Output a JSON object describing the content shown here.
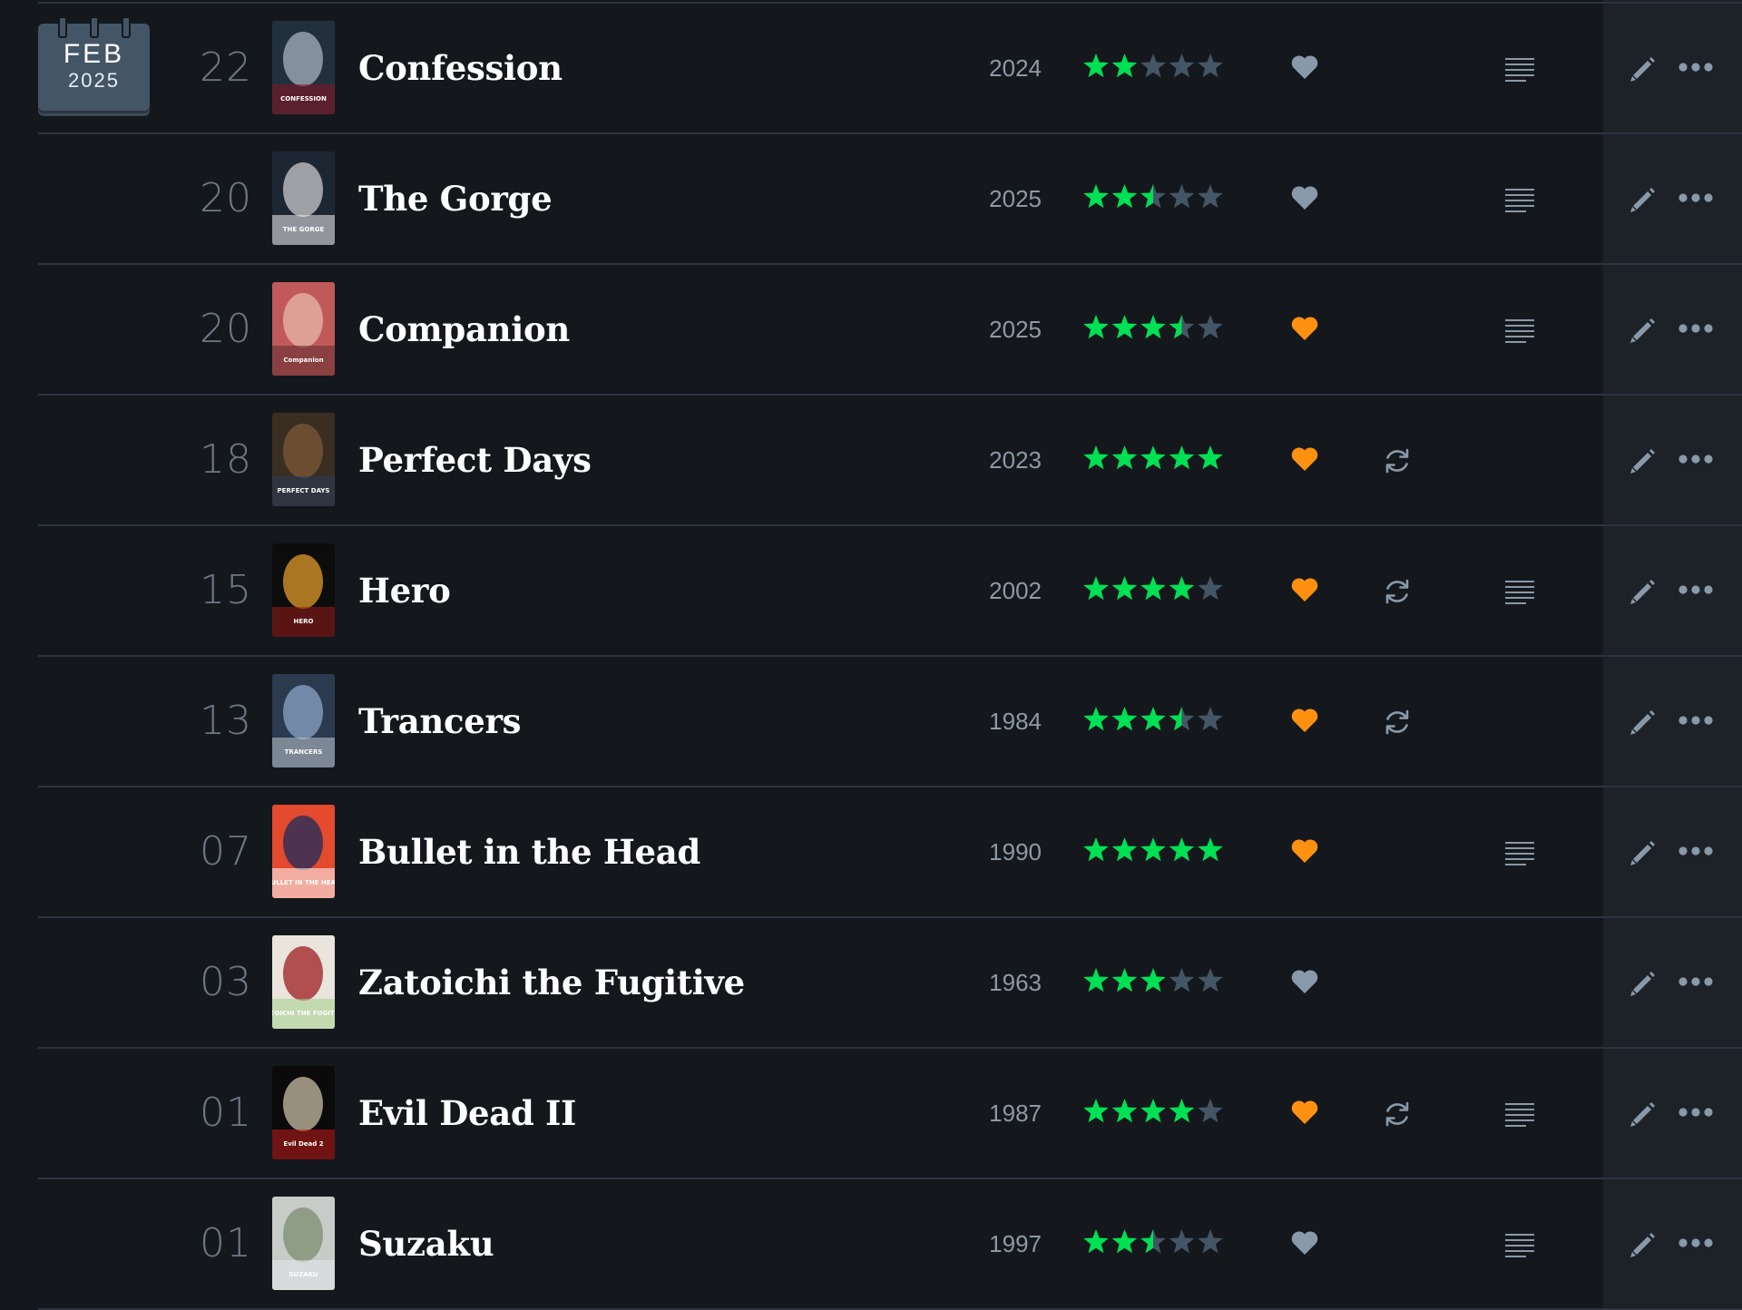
{
  "calendar": {
    "month": "FEB",
    "year": "2025"
  },
  "colors": {
    "star_on": "#00e054",
    "star_off": "#445566",
    "like_on": "#ff9010",
    "like_off": "#8899aa",
    "icon": "#8899aa",
    "background": "#14181c",
    "actions_background": "#1c2228"
  },
  "entries": [
    {
      "day": "22",
      "title": "Confession",
      "year": "2024",
      "rating": 2,
      "liked": false,
      "rewatch": false,
      "review": true,
      "poster_palette": [
        "#22303e",
        "#a6b0bb",
        "#8a1420"
      ],
      "poster_text": "CONFESSION"
    },
    {
      "day": "20",
      "title": "The Gorge",
      "year": "2025",
      "rating": 2.5,
      "liked": false,
      "rewatch": false,
      "review": true,
      "poster_palette": [
        "#1d2633",
        "#c9c9cc",
        "#f2f2f2"
      ],
      "poster_text": "THE GORGE"
    },
    {
      "day": "20",
      "title": "Companion",
      "year": "2025",
      "rating": 3.5,
      "liked": true,
      "rewatch": false,
      "review": true,
      "poster_palette": [
        "#c05a5a",
        "#e8b7a8",
        "#5c2c2c"
      ],
      "poster_text": "Companion"
    },
    {
      "day": "18",
      "title": "Perfect Days",
      "year": "2023",
      "rating": 5,
      "liked": true,
      "rewatch": true,
      "review": false,
      "poster_palette": [
        "#3a2e22",
        "#7c5a38",
        "#2a3c5c"
      ],
      "poster_text": "PERFECT DAYS"
    },
    {
      "day": "15",
      "title": "Hero",
      "year": "2002",
      "rating": 4,
      "liked": true,
      "rewatch": true,
      "review": true,
      "poster_palette": [
        "#0c0c0c",
        "#e09a28",
        "#9c1c1c"
      ],
      "poster_text": "HERO"
    },
    {
      "day": "13",
      "title": "Trancers",
      "year": "1984",
      "rating": 3.5,
      "liked": true,
      "rewatch": true,
      "review": false,
      "poster_palette": [
        "#2c3a50",
        "#8aa4c4",
        "#c0c8d0"
      ],
      "poster_text": "TRANCERS"
    },
    {
      "day": "07",
      "title": "Bullet in the Head",
      "year": "1990",
      "rating": 5,
      "liked": true,
      "rewatch": false,
      "review": true,
      "poster_palette": [
        "#e34a2e",
        "#1c2c5c",
        "#ffffff"
      ],
      "poster_text": "BULLET IN THE HEAD"
    },
    {
      "day": "03",
      "title": "Zatoichi the Fugitive",
      "year": "1963",
      "rating": 3,
      "liked": false,
      "rewatch": false,
      "review": false,
      "poster_palette": [
        "#e9e4dc",
        "#9c1c22",
        "#a4d08c"
      ],
      "poster_text": "ZATOICHI THE FUGITIVE"
    },
    {
      "day": "01",
      "title": "Evil Dead II",
      "year": "1987",
      "rating": 4,
      "liked": true,
      "rewatch": true,
      "review": true,
      "poster_palette": [
        "#0a0a0a",
        "#c8bca4",
        "#c21c1c"
      ],
      "poster_text": "Evil Dead 2"
    },
    {
      "day": "01",
      "title": "Suzaku",
      "year": "1997",
      "rating": 2.5,
      "liked": false,
      "rewatch": false,
      "review": true,
      "poster_palette": [
        "#c8ccc8",
        "#7c8c70",
        "#e4e8ec"
      ],
      "poster_text": "SUZAKU"
    }
  ]
}
